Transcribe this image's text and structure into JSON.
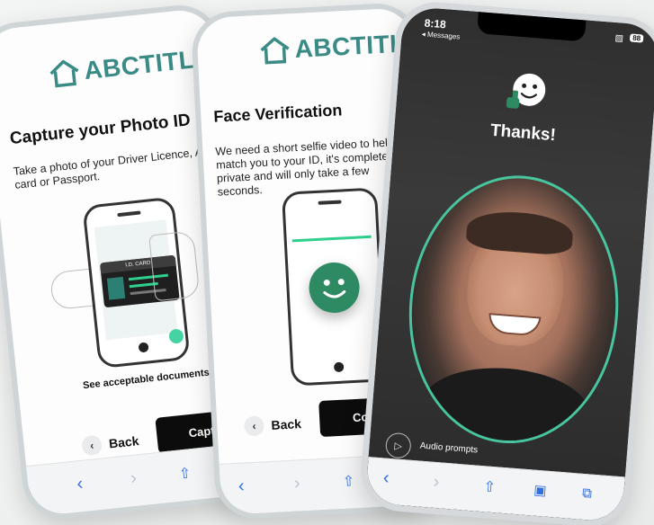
{
  "colors": {
    "accent": "#3a8a86",
    "verify_green": "#2d8a63",
    "oval_border": "#48c49e",
    "button_dark": "#0c0c0c"
  },
  "screen1": {
    "brand": "ABCTITLE",
    "title": "Capture your Photo ID",
    "description": "Take a photo of your Driver Licence, Age card or Passport.",
    "card_label": "I.D. CARD",
    "link": "See acceptable documents",
    "back_label": "Back",
    "primary_label": "Capture",
    "toolbar_icons": [
      "back-icon",
      "forward-icon",
      "share-icon"
    ]
  },
  "screen2": {
    "brand": "ABCTITLE",
    "title": "Face Verification",
    "description": "We need a short selfie video to help match you to your ID, it's completely private and will only take a few seconds.",
    "back_label": "Back",
    "primary_label": "Continue",
    "toolbar_icons": [
      "back-icon",
      "forward-icon",
      "share-icon"
    ]
  },
  "screen3": {
    "time": "8:18",
    "back_app": "◂ Messages",
    "battery": "88",
    "heading": "Thanks!",
    "audio_label": "Audio prompts",
    "toolbar_icons": [
      "back-icon",
      "forward-icon",
      "share-icon",
      "bookmarks-icon",
      "tabs-icon"
    ]
  }
}
